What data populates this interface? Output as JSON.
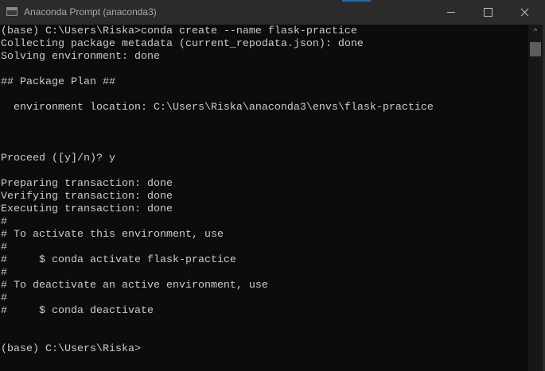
{
  "window": {
    "title": "Anaconda Prompt (anaconda3)"
  },
  "console": {
    "lines": [
      "(base) C:\\Users\\Riska>conda create --name flask-practice",
      "Collecting package metadata (current_repodata.json): done",
      "Solving environment: done",
      "",
      "## Package Plan ##",
      "",
      "  environment location: C:\\Users\\Riska\\anaconda3\\envs\\flask-practice",
      "",
      "",
      "",
      "Proceed ([y]/n)? y",
      "",
      "Preparing transaction: done",
      "Verifying transaction: done",
      "Executing transaction: done",
      "#",
      "# To activate this environment, use",
      "#",
      "#     $ conda activate flask-practice",
      "#",
      "# To deactivate an active environment, use",
      "#",
      "#     $ conda deactivate",
      "",
      "",
      "(base) C:\\Users\\Riska>"
    ]
  },
  "colors": {
    "background": "#0c0c0c",
    "text": "#cccccc",
    "titlebar": "#2b2b2b"
  }
}
